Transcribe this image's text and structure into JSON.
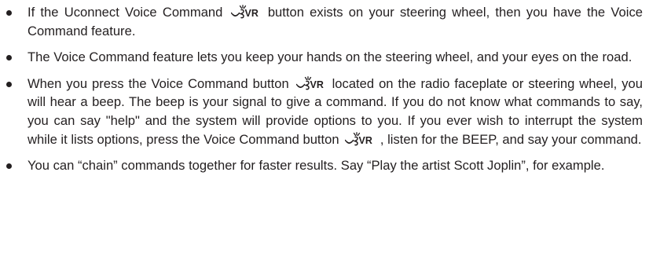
{
  "bullets": [
    {
      "before": "If the Uconnect Voice Command",
      "after": "button exists on your steering wheel, then you have the Voice Command feature."
    },
    {
      "text": "The Voice Command feature lets you keep your hands on the steering wheel, and your eyes on the road."
    },
    {
      "before": "When you press the Voice Command button",
      "middle": "located on the radio faceplate or steering wheel, you will hear a beep. The beep is your signal to give a command. If you do not know what commands to say, you can say \"help\" and the system will provide options to you. If you ever wish to interrupt the system while it lists options, press the Voice Command button",
      "after": ", listen for the BEEP, and say your command."
    },
    {
      "text": "You can “chain” commands together for faster results. Say “Play the artist Scott Joplin”, for example."
    }
  ],
  "icons": {
    "voice_command": "voice-command-vr-icon",
    "voice_command_label": "VR"
  }
}
